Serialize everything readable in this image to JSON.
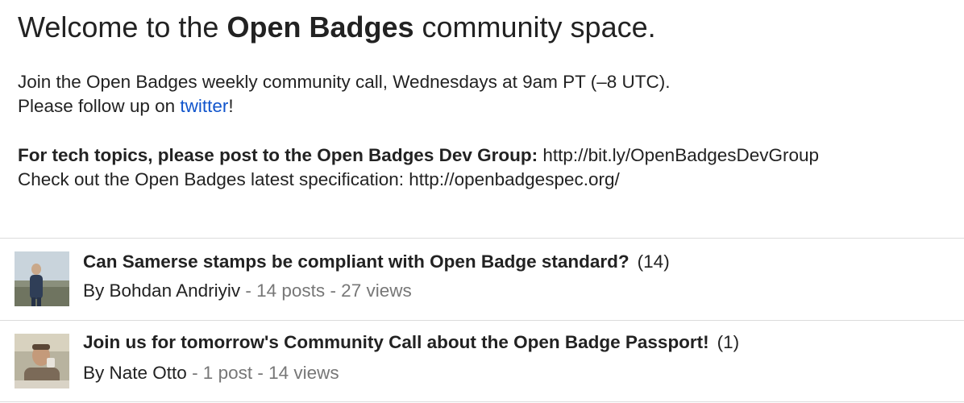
{
  "welcome": {
    "prefix": "Welcome to the ",
    "name": "Open Badges",
    "suffix": " community space."
  },
  "intro": {
    "line1": "Join the Open Badges weekly community call, Wednesdays at 9am PT (–8 UTC).",
    "line2_prefix": "Please follow up on ",
    "line2_link": "twitter",
    "line2_suffix": "!"
  },
  "tech": {
    "bold": "For tech topics, please post to the Open Badges Dev Group:",
    "url": " http://bit.ly/OpenBadgesDevGroup",
    "spec_line": "Check out the Open Badges latest specification: http://openbadgespec.org/"
  },
  "topics": [
    {
      "title": "Can Samerse stamps be compliant with Open Badge standard?",
      "count": "(14)",
      "by": "By Bohdan Andriyiv",
      "posts": " - 14 posts",
      "views": " - 27 views"
    },
    {
      "title": "Join us for tomorrow's Community Call about the Open Badge Passport!",
      "count": "(1)",
      "by": "By Nate Otto",
      "posts": " - 1 post",
      "views": " - 14 views"
    }
  ]
}
